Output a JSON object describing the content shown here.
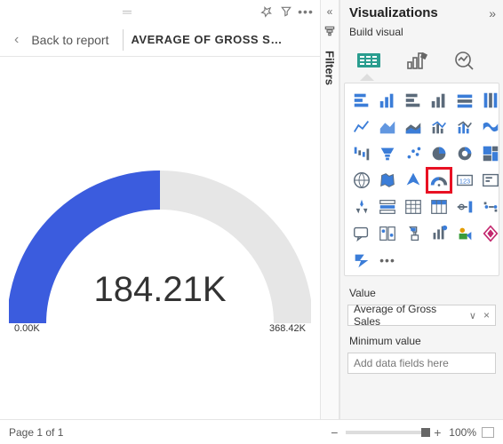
{
  "toolbar": {
    "back_label": "Back to report",
    "title": "AVERAGE OF GROSS SAL…"
  },
  "chart_data": {
    "type": "gauge",
    "value": 184.21,
    "min": 0.0,
    "max": 368.42,
    "unit": "K",
    "display_value": "184.21K",
    "min_label": "0.00K",
    "max_label": "368.42K",
    "fill_color": "#3b5cde",
    "track_color": "#e6e6e6"
  },
  "filters": {
    "label": "Filters"
  },
  "viz": {
    "title": "Visualizations",
    "subtitle": "Build visual",
    "tabs": [
      "build",
      "format",
      "analytics"
    ],
    "icons": [
      "stacked-bar",
      "stacked-column",
      "clustered-bar",
      "clustered-column",
      "100-stacked-bar",
      "100-stacked-column",
      "line",
      "area",
      "stacked-area",
      "line-stacked-column",
      "line-clustered-column",
      "ribbon",
      "waterfall",
      "funnel",
      "scatter",
      "pie",
      "donut",
      "treemap",
      "map",
      "filled-map",
      "azure-map",
      "gauge",
      "card",
      "kpi",
      "multi-row-card",
      "slicer",
      "table",
      "matrix",
      "r-visual",
      "python-visual",
      "qa",
      "key-influencers",
      "decomposition",
      "narrative",
      "paginated",
      "power-apps",
      "power-automate",
      "more"
    ],
    "highlighted": "gauge",
    "fields": {
      "value_label": "Value",
      "value_item": "Average of Gross Sales",
      "min_label": "Minimum value",
      "min_placeholder": "Add data fields here"
    }
  },
  "status": {
    "page": "Page 1 of 1",
    "zoom_pct": "100%"
  }
}
